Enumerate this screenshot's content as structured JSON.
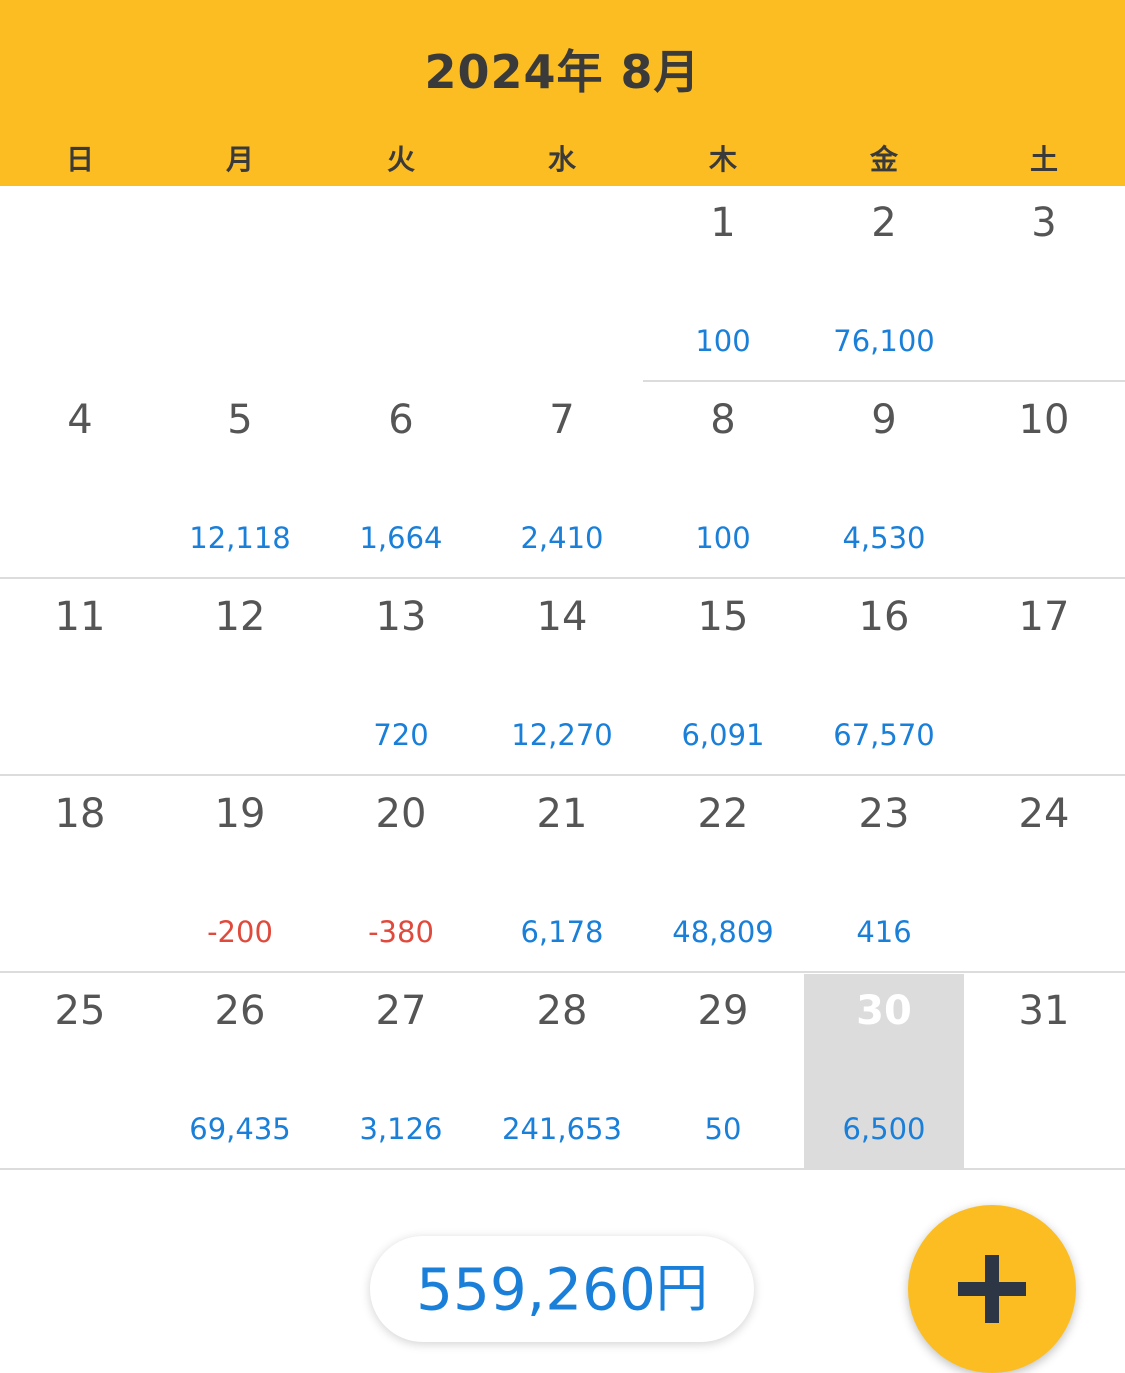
{
  "header": {
    "title": "2024年 8月",
    "weekdays": [
      "日",
      "月",
      "火",
      "水",
      "木",
      "金",
      "土"
    ]
  },
  "calendar": {
    "weeks": [
      [
        {
          "day": "",
          "amount": ""
        },
        {
          "day": "",
          "amount": ""
        },
        {
          "day": "",
          "amount": ""
        },
        {
          "day": "",
          "amount": ""
        },
        {
          "day": "1",
          "amount": "100"
        },
        {
          "day": "2",
          "amount": "76,100"
        },
        {
          "day": "3",
          "amount": ""
        }
      ],
      [
        {
          "day": "4",
          "amount": ""
        },
        {
          "day": "5",
          "amount": "12,118"
        },
        {
          "day": "6",
          "amount": "1,664"
        },
        {
          "day": "7",
          "amount": "2,410"
        },
        {
          "day": "8",
          "amount": "100"
        },
        {
          "day": "9",
          "amount": "4,530"
        },
        {
          "day": "10",
          "amount": ""
        }
      ],
      [
        {
          "day": "11",
          "amount": ""
        },
        {
          "day": "12",
          "amount": ""
        },
        {
          "day": "13",
          "amount": "720"
        },
        {
          "day": "14",
          "amount": "12,270"
        },
        {
          "day": "15",
          "amount": "6,091"
        },
        {
          "day": "16",
          "amount": "67,570"
        },
        {
          "day": "17",
          "amount": ""
        }
      ],
      [
        {
          "day": "18",
          "amount": ""
        },
        {
          "day": "19",
          "amount": "-200",
          "negative": true
        },
        {
          "day": "20",
          "amount": "-380",
          "negative": true
        },
        {
          "day": "21",
          "amount": "6,178"
        },
        {
          "day": "22",
          "amount": "48,809"
        },
        {
          "day": "23",
          "amount": "416"
        },
        {
          "day": "24",
          "amount": ""
        }
      ],
      [
        {
          "day": "25",
          "amount": ""
        },
        {
          "day": "26",
          "amount": "69,435"
        },
        {
          "day": "27",
          "amount": "3,126"
        },
        {
          "day": "28",
          "amount": "241,653"
        },
        {
          "day": "29",
          "amount": "50"
        },
        {
          "day": "30",
          "amount": "6,500",
          "today": true
        },
        {
          "day": "31",
          "amount": ""
        }
      ]
    ]
  },
  "total": {
    "value": "559,260",
    "unit": "円"
  },
  "fab": {
    "icon": "plus-icon"
  },
  "colors": {
    "header_bg": "#fbbd22",
    "positive": "#1a7fd8",
    "negative": "#e04a3c",
    "today_bg": "#dcdcdc"
  }
}
